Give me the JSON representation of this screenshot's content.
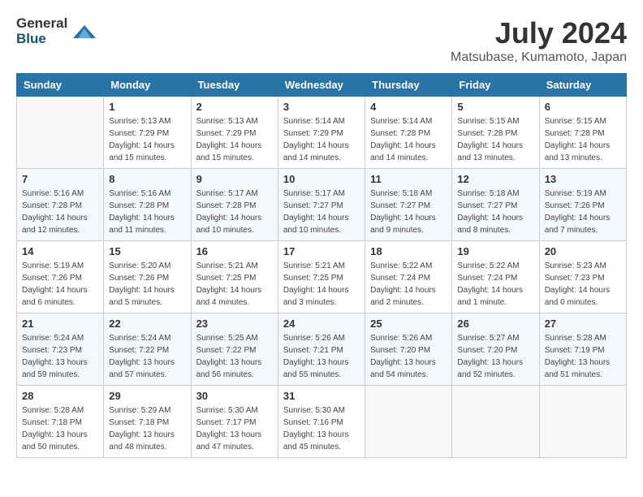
{
  "header": {
    "logo_general": "General",
    "logo_blue": "Blue",
    "title": "July 2024",
    "location": "Matsubase, Kumamoto, Japan"
  },
  "weekdays": [
    "Sunday",
    "Monday",
    "Tuesday",
    "Wednesday",
    "Thursday",
    "Friday",
    "Saturday"
  ],
  "weeks": [
    [
      {
        "day": null
      },
      {
        "day": "1",
        "sunrise": "5:13 AM",
        "sunset": "7:29 PM",
        "daylight": "14 hours and 15 minutes."
      },
      {
        "day": "2",
        "sunrise": "5:13 AM",
        "sunset": "7:29 PM",
        "daylight": "14 hours and 15 minutes."
      },
      {
        "day": "3",
        "sunrise": "5:14 AM",
        "sunset": "7:29 PM",
        "daylight": "14 hours and 14 minutes."
      },
      {
        "day": "4",
        "sunrise": "5:14 AM",
        "sunset": "7:28 PM",
        "daylight": "14 hours and 14 minutes."
      },
      {
        "day": "5",
        "sunrise": "5:15 AM",
        "sunset": "7:28 PM",
        "daylight": "14 hours and 13 minutes."
      },
      {
        "day": "6",
        "sunrise": "5:15 AM",
        "sunset": "7:28 PM",
        "daylight": "14 hours and 13 minutes."
      }
    ],
    [
      {
        "day": "7",
        "sunrise": "5:16 AM",
        "sunset": "7:28 PM",
        "daylight": "14 hours and 12 minutes."
      },
      {
        "day": "8",
        "sunrise": "5:16 AM",
        "sunset": "7:28 PM",
        "daylight": "14 hours and 11 minutes."
      },
      {
        "day": "9",
        "sunrise": "5:17 AM",
        "sunset": "7:28 PM",
        "daylight": "14 hours and 10 minutes."
      },
      {
        "day": "10",
        "sunrise": "5:17 AM",
        "sunset": "7:27 PM",
        "daylight": "14 hours and 10 minutes."
      },
      {
        "day": "11",
        "sunrise": "5:18 AM",
        "sunset": "7:27 PM",
        "daylight": "14 hours and 9 minutes."
      },
      {
        "day": "12",
        "sunrise": "5:18 AM",
        "sunset": "7:27 PM",
        "daylight": "14 hours and 8 minutes."
      },
      {
        "day": "13",
        "sunrise": "5:19 AM",
        "sunset": "7:26 PM",
        "daylight": "14 hours and 7 minutes."
      }
    ],
    [
      {
        "day": "14",
        "sunrise": "5:19 AM",
        "sunset": "7:26 PM",
        "daylight": "14 hours and 6 minutes."
      },
      {
        "day": "15",
        "sunrise": "5:20 AM",
        "sunset": "7:26 PM",
        "daylight": "14 hours and 5 minutes."
      },
      {
        "day": "16",
        "sunrise": "5:21 AM",
        "sunset": "7:25 PM",
        "daylight": "14 hours and 4 minutes."
      },
      {
        "day": "17",
        "sunrise": "5:21 AM",
        "sunset": "7:25 PM",
        "daylight": "14 hours and 3 minutes."
      },
      {
        "day": "18",
        "sunrise": "5:22 AM",
        "sunset": "7:24 PM",
        "daylight": "14 hours and 2 minutes."
      },
      {
        "day": "19",
        "sunrise": "5:22 AM",
        "sunset": "7:24 PM",
        "daylight": "14 hours and 1 minute."
      },
      {
        "day": "20",
        "sunrise": "5:23 AM",
        "sunset": "7:23 PM",
        "daylight": "14 hours and 0 minutes."
      }
    ],
    [
      {
        "day": "21",
        "sunrise": "5:24 AM",
        "sunset": "7:23 PM",
        "daylight": "13 hours and 59 minutes."
      },
      {
        "day": "22",
        "sunrise": "5:24 AM",
        "sunset": "7:22 PM",
        "daylight": "13 hours and 57 minutes."
      },
      {
        "day": "23",
        "sunrise": "5:25 AM",
        "sunset": "7:22 PM",
        "daylight": "13 hours and 56 minutes."
      },
      {
        "day": "24",
        "sunrise": "5:26 AM",
        "sunset": "7:21 PM",
        "daylight": "13 hours and 55 minutes."
      },
      {
        "day": "25",
        "sunrise": "5:26 AM",
        "sunset": "7:20 PM",
        "daylight": "13 hours and 54 minutes."
      },
      {
        "day": "26",
        "sunrise": "5:27 AM",
        "sunset": "7:20 PM",
        "daylight": "13 hours and 52 minutes."
      },
      {
        "day": "27",
        "sunrise": "5:28 AM",
        "sunset": "7:19 PM",
        "daylight": "13 hours and 51 minutes."
      }
    ],
    [
      {
        "day": "28",
        "sunrise": "5:28 AM",
        "sunset": "7:18 PM",
        "daylight": "13 hours and 50 minutes."
      },
      {
        "day": "29",
        "sunrise": "5:29 AM",
        "sunset": "7:18 PM",
        "daylight": "13 hours and 48 minutes."
      },
      {
        "day": "30",
        "sunrise": "5:30 AM",
        "sunset": "7:17 PM",
        "daylight": "13 hours and 47 minutes."
      },
      {
        "day": "31",
        "sunrise": "5:30 AM",
        "sunset": "7:16 PM",
        "daylight": "13 hours and 45 minutes."
      },
      {
        "day": null
      },
      {
        "day": null
      },
      {
        "day": null
      }
    ]
  ],
  "labels": {
    "sunrise_prefix": "Sunrise: ",
    "sunset_prefix": "Sunset: ",
    "daylight_prefix": "Daylight: "
  }
}
